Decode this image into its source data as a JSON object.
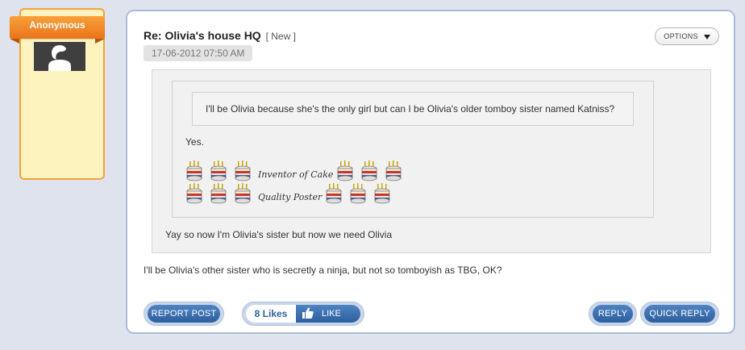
{
  "user": {
    "name": "Anonymous"
  },
  "post": {
    "title": "Re: Olivia's house HQ",
    "new_tag": "[ New ]",
    "date": "17-06-2012 07:50 AM",
    "options_label": "OPTIONS",
    "nested_quote_text": "I'll be Olivia because she's the only girl but can I be Olivia's older tomboy sister named Katniss?",
    "quote_reply_text": "Yes.",
    "signature": {
      "line1": "Inventor of Cake",
      "line2": "Quality Poster"
    },
    "quote_text": "Yay so now I'm Olivia's sister but now we need Olivia",
    "body": "I'll be Olivia's other sister who is secretly a ninja, but not so tomboyish as TBG, OK?"
  },
  "actions": {
    "report_label": "REPORT POST",
    "likes_count": "8 Likes",
    "like_label": "LIKE",
    "reply_label": "REPLY",
    "quick_reply_label": "QUICK REPLY"
  },
  "colors": {
    "accent_orange": "#f2a33a",
    "button_blue": "#2d5f9e",
    "card_border": "#a9bcd8"
  },
  "icons": [
    "avatar-silhouette-icon",
    "chevron-down-icon",
    "cake-icon",
    "thumbs-up-icon"
  ]
}
